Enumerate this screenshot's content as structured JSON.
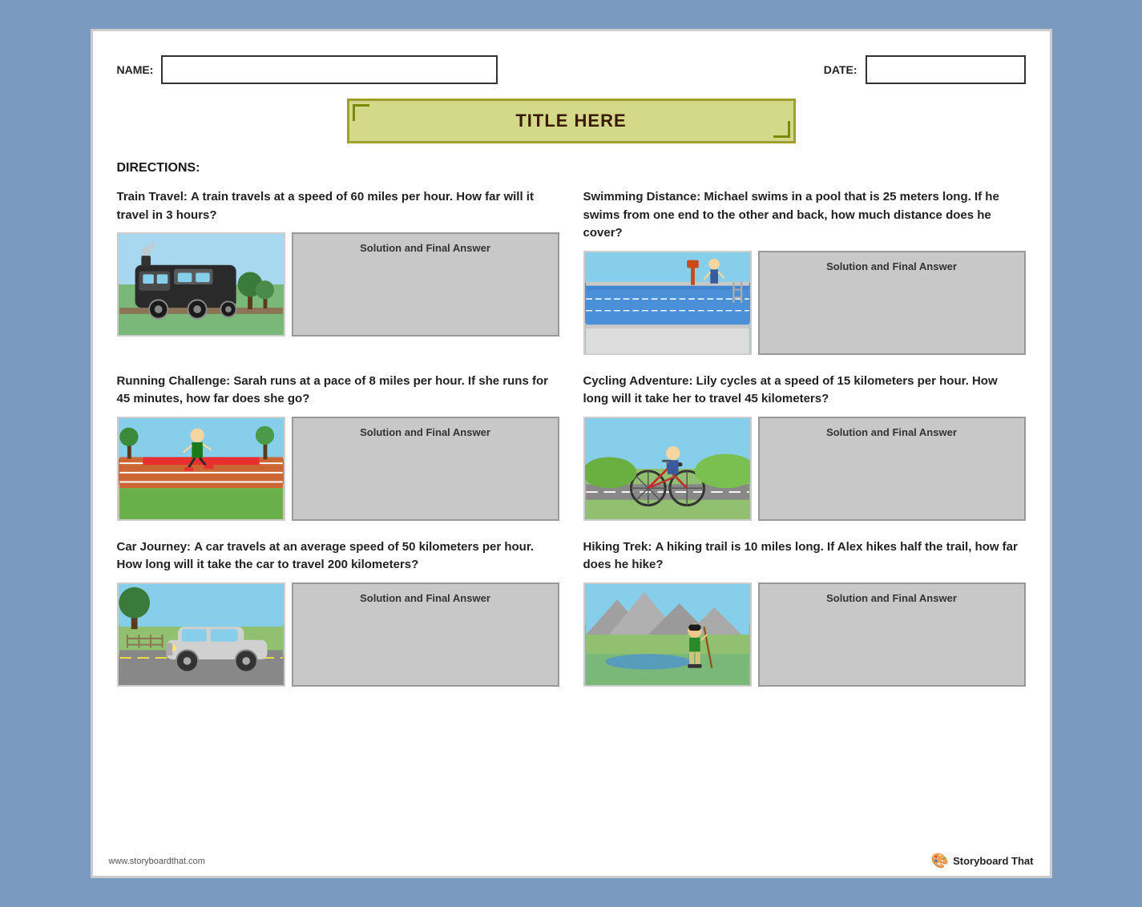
{
  "header": {
    "name_label": "NAME:",
    "date_label": "DATE:",
    "name_placeholder": "",
    "date_placeholder": ""
  },
  "title": {
    "text": "TITLE HERE"
  },
  "directions": {
    "label": "DIRECTIONS:"
  },
  "footer": {
    "url": "www.storyboardthat.com",
    "brand": "Storyboard That"
  },
  "solution_label": "Solution and Final Answer",
  "problems": [
    {
      "id": "train",
      "label": "Train Travel:",
      "text": "A train travels at a speed of 60 miles per hour. How far will it travel in 3 hours?",
      "scene": "scene-train",
      "icon": "🚂"
    },
    {
      "id": "swimming",
      "label": "Swimming Distance:",
      "text": "Michael swims in a pool that is 25 meters long. If he swims from one end to the other and back, how much distance does he cover?",
      "scene": "scene-pool",
      "icon": "🏊"
    },
    {
      "id": "running",
      "label": "Running Challenge:",
      "text": "Sarah runs at a pace of 8 miles per hour. If she runs for 45 minutes, how far does she go?",
      "scene": "scene-running",
      "icon": "🏃"
    },
    {
      "id": "cycling",
      "label": "Cycling Adventure:",
      "text": "Lily cycles at a speed of 15 kilometers per hour. How long will it take her to travel 45 kilometers?",
      "scene": "scene-cycling",
      "icon": "🚴"
    },
    {
      "id": "car",
      "label": "Car Journey:",
      "text": "A car travels at an average speed of 50 kilometers per hour. How long will it take the car to travel 200 kilometers?",
      "scene": "scene-car",
      "icon": "🚗"
    },
    {
      "id": "hiking",
      "label": "Hiking Trek:",
      "text": "A hiking trail is 10 miles long. If Alex hikes half the trail, how far does he hike?",
      "scene": "scene-hiking",
      "icon": "🥾"
    }
  ]
}
